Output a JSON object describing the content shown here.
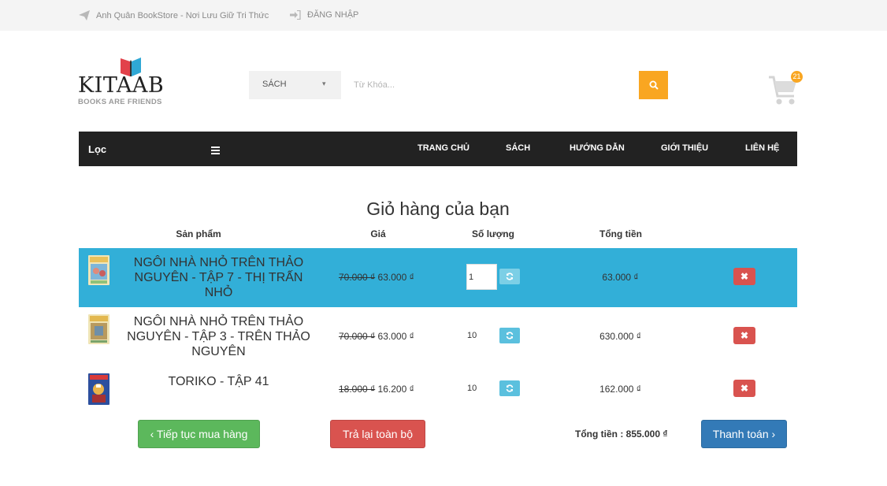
{
  "topbar": {
    "store_text": "Anh Quân BookStore - Nơi Lưu Giữ Tri Thức",
    "login_text": "ĐĂNG NHẬP",
    "store_icon": "paper-plane-icon",
    "login_icon": "sign-in-icon"
  },
  "logo": {
    "wordmark": "KITAAB",
    "tagline": "BOOKS ARE FRIENDS"
  },
  "search": {
    "category": "SÁCH",
    "placeholder": "Từ Khóa...",
    "button_icon": "search-icon"
  },
  "cart": {
    "count": "21",
    "icon": "shopping-cart-icon"
  },
  "nav": {
    "filter_label": "Lọc",
    "menu_icon": "bars-icon",
    "items": [
      "TRANG CHỦ",
      "SÁCH",
      "HƯỚNG DẪN",
      "GIỚI THIỆU",
      "LIÊN HỆ"
    ]
  },
  "cart_page": {
    "title": "Giỏ hàng của bạn",
    "headers": {
      "product": "Sản phẩm",
      "price": "Giá",
      "quantity": "Số lượng",
      "total": "Tổng tiền"
    },
    "items": [
      {
        "name": "NGÔI NHÀ NHỎ TRÊN THẢO NGUYÊN - TẬP 7 - THỊ TRẤN NHỎ",
        "old_price": "70.000 ₫",
        "price": "63.000 ₫",
        "quantity": "1",
        "total": "63.000 ₫",
        "delete_icon": "times-icon",
        "refresh_icon": "refresh-icon"
      },
      {
        "name": "NGÔI NHÀ NHỎ TRÊN THẢO NGUYÊN - TẬP 3 - TRÊN THẢO NGUYÊN",
        "old_price": "70.000 ₫",
        "price": "63.000 ₫",
        "quantity": "10",
        "total": "630.000 ₫",
        "delete_icon": "times-icon",
        "refresh_icon": "refresh-icon"
      },
      {
        "name": "TORIKO - TẬP 41",
        "old_price": "18.000 ₫",
        "price": "16.200 ₫",
        "quantity": "10",
        "total": "162.000 ₫",
        "delete_icon": "times-icon",
        "refresh_icon": "refresh-icon"
      }
    ],
    "continue_label": "‹ Tiếp tục mua hàng",
    "clear_label": "Trả lại toàn bộ",
    "grand_total": "Tổng tiền : 855.000 ₫",
    "checkout_label": "Thanh toán ›"
  },
  "colors": {
    "accent": "#f9a621",
    "nav_bg": "#222222",
    "highlight_row": "#32afd8",
    "continue_btn": "#5cb85c",
    "clear_btn": "#d9534f",
    "checkout_btn": "#337ab7"
  }
}
